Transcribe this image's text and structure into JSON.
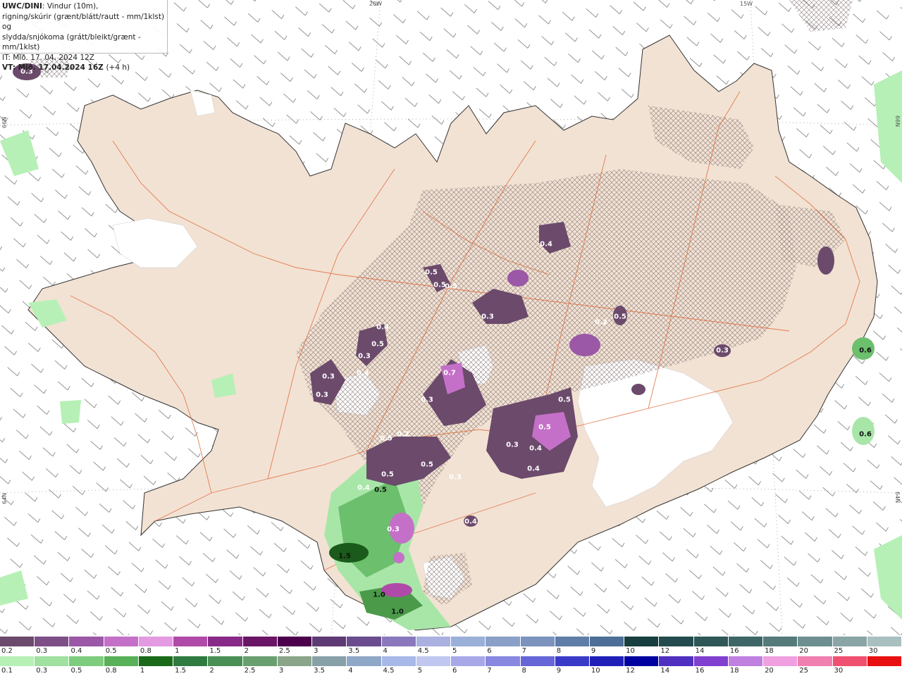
{
  "header": {
    "model": "UWC/DINI",
    "line1": ": Vindur (10m),",
    "line2": "rigning/skúrir (grænt/blátt/rautt - mm/1klst) og",
    "line3": "slydda/snjókoma (grátt/bleikt/grænt - mm/1klst)",
    "init_time": "IT: Mið. 17. 04. 2024 12Z",
    "valid_time": "VT: Mið. 17.04.2024 16Z",
    "lead": "(+4 h)"
  },
  "grid_labels": {
    "lon_20w": "20W",
    "lon_15w": "15W",
    "lat_66n_left": "66N",
    "lat_66n_right": "66N",
    "lat_64n_left": "64N",
    "lat_64n_right": "64N"
  },
  "map_values": [
    {
      "v": "0.3",
      "dark": false
    },
    {
      "v": "0.4",
      "dark": false
    },
    {
      "v": "0.5",
      "dark": false
    },
    {
      "v": "0.3",
      "dark": false
    },
    {
      "v": "0.3",
      "dark": false
    },
    {
      "v": "0.3",
      "dark": false
    },
    {
      "v": "0.4",
      "dark": false
    },
    {
      "v": "0.5",
      "dark": false
    },
    {
      "v": "0.5",
      "dark": false
    },
    {
      "v": "0.5",
      "dark": false
    },
    {
      "v": "0.3",
      "dark": false
    },
    {
      "v": "0.7",
      "dark": false
    },
    {
      "v": "0.3",
      "dark": false
    },
    {
      "v": "0.2",
      "dark": false
    },
    {
      "v": "0.5",
      "dark": false
    },
    {
      "v": "0.5",
      "dark": false
    },
    {
      "v": "0.3",
      "dark": false
    },
    {
      "v": "0.3",
      "dark": false
    },
    {
      "v": "0.4",
      "dark": false
    },
    {
      "v": "0.5",
      "dark": false
    },
    {
      "v": "0.4",
      "dark": false
    },
    {
      "v": "0.2",
      "dark": false
    },
    {
      "v": "0.5",
      "dark": false
    },
    {
      "v": "0.4",
      "dark": false
    },
    {
      "v": "0.5",
      "dark": false
    },
    {
      "v": "0.6",
      "dark": true
    },
    {
      "v": "0.6",
      "dark": true
    },
    {
      "v": "0.5",
      "dark": true
    },
    {
      "v": "1.0",
      "dark": true
    },
    {
      "v": "1.0",
      "dark": true
    },
    {
      "v": "1.5",
      "dark": true
    },
    {
      "v": "0.4",
      "dark": false
    },
    {
      "v": "0.3",
      "dark": false
    },
    {
      "v": "0.5",
      "dark": false
    },
    {
      "v": "0.4",
      "dark": false
    },
    {
      "v": "0.3",
      "dark": false
    }
  ],
  "scale_top": {
    "colors": [
      "#6b4a6b",
      "#7e4f86",
      "#9a58a6",
      "#c470c8",
      "#e39ae2",
      "#b04aa8",
      "#8a2a88",
      "#6a1566",
      "#4c004c",
      "#5e3a74",
      "#6b4d8f",
      "#8a78bd",
      "#aab0e0",
      "#9ab0d8",
      "#8aa0c8",
      "#7b93bd",
      "#5e7ea8",
      "#4d6e96",
      "#173f3f",
      "#234b4f",
      "#2f5757",
      "#3f6666",
      "#557a7a",
      "#6e8f8f",
      "#8aa5a5",
      "#aabfbf"
    ],
    "labels": [
      "0.2",
      "0.3",
      "0.4",
      "0.5",
      "0.8",
      "1",
      "1.5",
      "2",
      "2.5",
      "3",
      "3.5",
      "4",
      "4.5",
      "5",
      "6",
      "7",
      "8",
      "9",
      "10",
      "12",
      "14",
      "16",
      "18",
      "20",
      "25",
      "30"
    ]
  },
  "scale_bottom": {
    "colors": [
      "#b6f0b6",
      "#a0e0a0",
      "#7ecc7e",
      "#58b058",
      "#1a6a1a",
      "#2f7a40",
      "#4a8f55",
      "#6aa070",
      "#8aa58a",
      "#88a0a8",
      "#90a8c8",
      "#a8b8e8",
      "#c0c8f0",
      "#a8a8e8",
      "#8888e0",
      "#6666d8",
      "#3a3ac8",
      "#2020b8",
      "#0000a0",
      "#5030c0",
      "#8040d0",
      "#c080e0",
      "#f0a0e0",
      "#f080b0",
      "#f05070",
      "#e81010"
    ],
    "labels": [
      "0.1",
      "0.3",
      "0.5",
      "0.8",
      "1",
      "1.5",
      "2",
      "2.5",
      "3",
      "3.5",
      "4",
      "4.5",
      "5",
      "6",
      "7",
      "8",
      "9",
      "10",
      "12",
      "14",
      "16",
      "18",
      "20",
      "25",
      "30"
    ]
  }
}
